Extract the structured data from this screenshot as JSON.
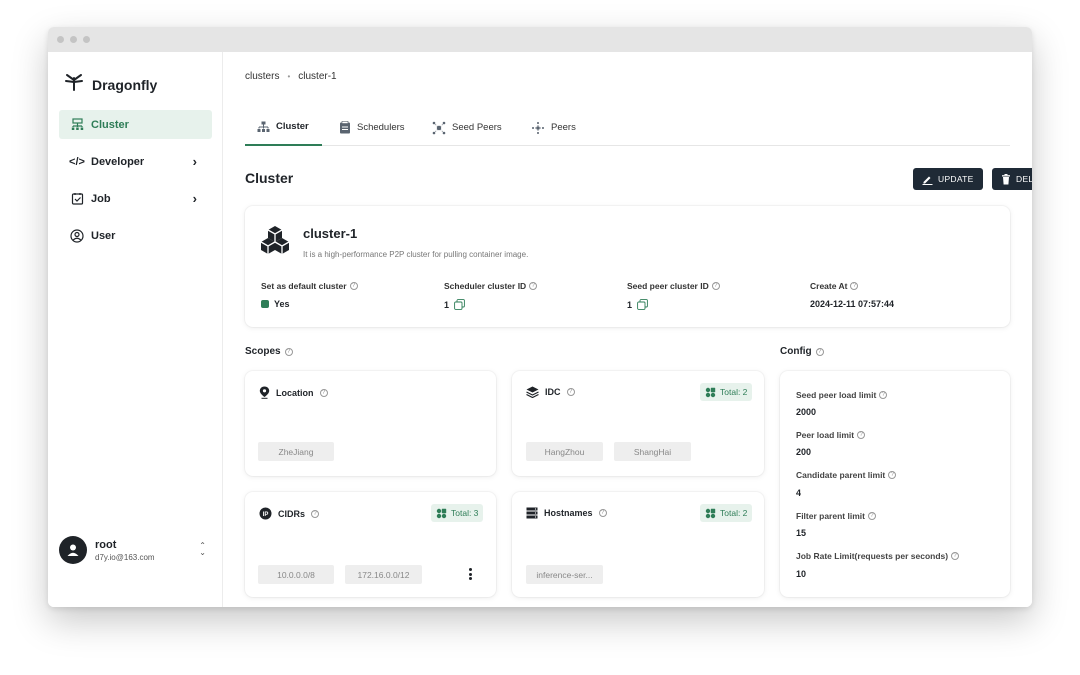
{
  "brand": {
    "name": "Dragonfly"
  },
  "sidebar": {
    "items": [
      {
        "label": "Cluster",
        "icon": "cluster-icon",
        "active": true
      },
      {
        "label": "Developer",
        "icon": "code-icon",
        "expandable": true
      },
      {
        "label": "Job",
        "icon": "job-icon",
        "expandable": true
      },
      {
        "label": "User",
        "icon": "user-icon"
      }
    ]
  },
  "user": {
    "name": "root",
    "email": "d7y.io@163.com"
  },
  "breadcrumb": [
    "clusters",
    "cluster-1"
  ],
  "tabs": [
    {
      "label": "Cluster",
      "icon": "cluster-tab-icon",
      "active": true
    },
    {
      "label": "Schedulers",
      "icon": "scheduler-icon"
    },
    {
      "label": "Seed Peers",
      "icon": "seed-peer-icon"
    },
    {
      "label": "Peers",
      "icon": "peer-icon"
    }
  ],
  "page": {
    "title": "Cluster"
  },
  "actions": {
    "update": "UPDATE",
    "delete": "DELETE"
  },
  "cluster": {
    "name": "cluster-1",
    "description": "It is a high-performance P2P cluster for pulling container image.",
    "fields": [
      {
        "label": "Set as default cluster",
        "value": "Yes"
      },
      {
        "label": "Scheduler cluster ID",
        "value": "1"
      },
      {
        "label": "Seed peer cluster ID",
        "value": "1"
      },
      {
        "label": "Create At",
        "value": "2024-12-11 07:57:44"
      }
    ]
  },
  "scopes": {
    "title": "Scopes",
    "location": {
      "title": "Location",
      "chips": [
        "ZheJiang"
      ]
    },
    "idc": {
      "title": "IDC",
      "total": "Total: 2",
      "chips": [
        "HangZhou",
        "ShangHai"
      ]
    },
    "cidrs": {
      "title": "CIDRs",
      "total": "Total: 3",
      "chips": [
        "10.0.0.0/8",
        "172.16.0.0/12"
      ]
    },
    "hostnames": {
      "title": "Hostnames",
      "total": "Total: 2",
      "chips": [
        "inference-ser..."
      ]
    }
  },
  "config": {
    "title": "Config",
    "items": [
      {
        "label": "Seed peer load limit",
        "value": "2000"
      },
      {
        "label": "Peer load limit",
        "value": "200"
      },
      {
        "label": "Candidate parent limit",
        "value": "4"
      },
      {
        "label": "Filter parent limit",
        "value": "15"
      },
      {
        "label": "Job Rate Limit(requests per seconds)",
        "value": "10"
      }
    ]
  },
  "colors": {
    "accent": "#2e7d57",
    "dark": "#1f2a36",
    "active_bg": "#e7f2ec"
  }
}
